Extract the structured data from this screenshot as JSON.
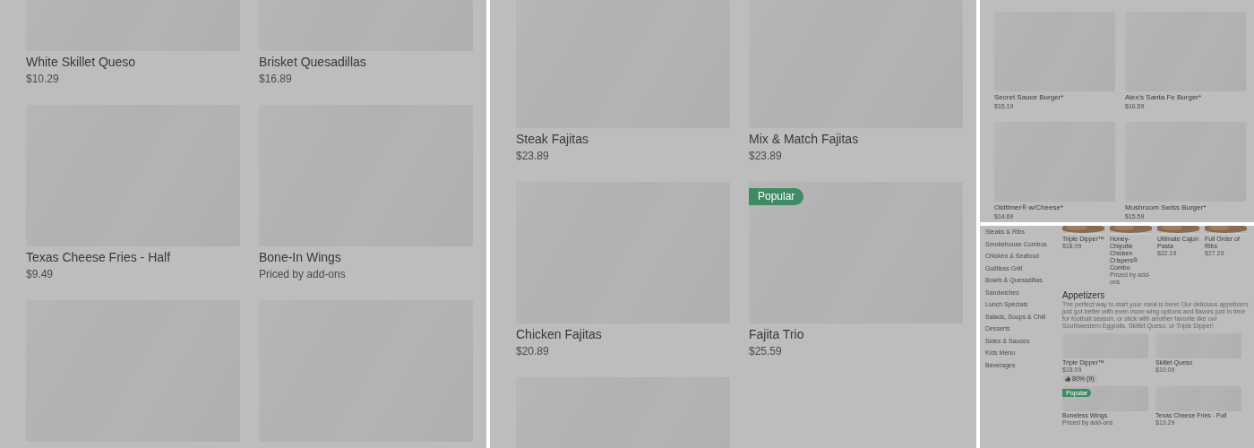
{
  "panels": [
    {
      "items": [
        {
          "kind": "dish",
          "name": "White Skillet Queso",
          "price": "$10.29"
        },
        {
          "kind": "dish",
          "name": "Brisket Quesadillas",
          "price": "$16.89"
        },
        {
          "kind": "dish",
          "name": "Texas Cheese Fries - Half",
          "price": "$9.49"
        },
        {
          "kind": "dish",
          "name": "Bone-In Wings",
          "price": "Priced by add-ons"
        },
        {
          "kind": "picture"
        },
        {
          "kind": "picture"
        }
      ]
    },
    {
      "rows": [
        [
          {
            "kind": "dish",
            "name": "Steak Fajitas",
            "price": "$23.89"
          },
          {
            "kind": "dish",
            "name": "Mix & Match Fajitas",
            "price": "$23.89"
          }
        ],
        [
          {
            "kind": "dish",
            "name": "Chicken Fajitas",
            "price": "$20.89"
          },
          {
            "kind": "dish",
            "name": "Fajita Trio",
            "price": "$25.59",
            "badge": "Popular"
          }
        ],
        [
          {
            "kind": "picture"
          }
        ]
      ]
    },
    {
      "items": [
        {
          "name": "Secret Sauce Burger*",
          "price": "$15.19"
        },
        {
          "name": "Alex's Santa Fe Burger*",
          "price": "$16.59"
        },
        {
          "name": "Oldtimer® w/Cheese*",
          "price": "$14.69"
        },
        {
          "name": "Mushroom Swiss Burger*",
          "price": "$15.59"
        }
      ]
    }
  ],
  "menu_page": {
    "categories": [
      "Steaks & Ribs",
      "Smokehouse Combos",
      "Chicken & Seafood",
      "Guiltless Grill",
      "Bowls & Quesadillas",
      "Sandwiches",
      "Lunch Specials",
      "Salads, Soups & Chili",
      "Desserts",
      "Sides & Sauces",
      "Kids Menu",
      "Beverages"
    ],
    "featured": [
      {
        "name": "Triple Dipper™",
        "price": "$18.09"
      },
      {
        "name": "Honey-Chipotle Chicken Crispers® Combo",
        "price": "Priced by add-ons"
      },
      {
        "name": "Ultimate Cajun Pasta",
        "price": "$22.19"
      },
      {
        "name": "Full Order of Ribs",
        "price": "$27.29"
      }
    ],
    "section": {
      "title": "Appetizers",
      "description": "The perfect way to start your meal is here! Our delicious appetizers just got better with even more wing options and flavors just in time for football season, or stick with another favorite like our Southwestern Eggrolls, Skillet Queso, or Triple Dipper!",
      "items": [
        {
          "name": "Triple Dipper™",
          "price": "$18.09",
          "rating": "80% (9)"
        },
        {
          "name": "Skillet Queso",
          "price": "$10.09"
        },
        {
          "name": "Boneless Wings",
          "price": "Priced by add-ons",
          "badge": "Popular"
        },
        {
          "name": "Texas Cheese Fries - Full",
          "price": "$13.29"
        }
      ]
    }
  }
}
